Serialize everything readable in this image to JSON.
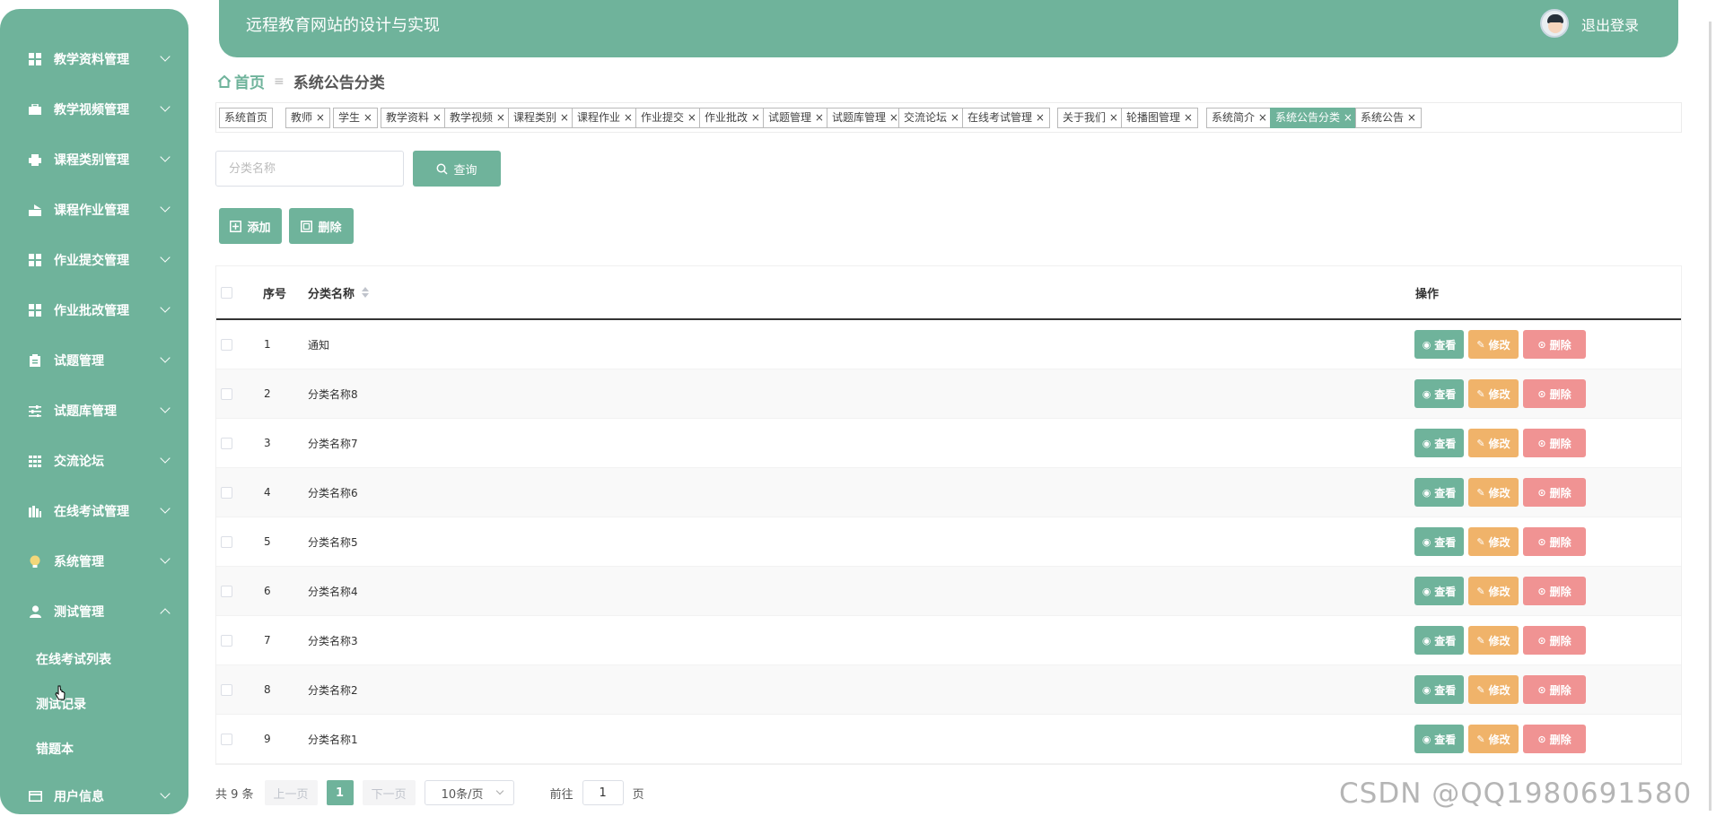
{
  "sidebar": {
    "items": [
      {
        "label": "教学资料管理",
        "icon": "grid-icon"
      },
      {
        "label": "教学视频管理",
        "icon": "briefcase-icon"
      },
      {
        "label": "课程类别管理",
        "icon": "printer-icon"
      },
      {
        "label": "课程作业管理",
        "icon": "chart-icon"
      },
      {
        "label": "作业提交管理",
        "icon": "grid-icon"
      },
      {
        "label": "作业批改管理",
        "icon": "grid-icon"
      },
      {
        "label": "试题管理",
        "icon": "clipboard-icon"
      },
      {
        "label": "试题库管理",
        "icon": "sliders-icon"
      },
      {
        "label": "交流论坛",
        "icon": "table-icon"
      },
      {
        "label": "在线考试管理",
        "icon": "bars-icon"
      },
      {
        "label": "系统管理",
        "icon": "bulb-icon"
      },
      {
        "label": "测试管理",
        "icon": "user-icon"
      }
    ],
    "sub_items": [
      "在线考试列表",
      "测试记录",
      "错题本"
    ],
    "last_item": {
      "label": "用户信息",
      "icon": "card-icon"
    }
  },
  "header": {
    "title": "远程教育网站的设计与实现",
    "logout": "退出登录"
  },
  "breadcrumb": {
    "home": "首页",
    "separator": "≡",
    "current": "系统公告分类"
  },
  "tags": [
    "系统首页",
    "教师",
    "学生",
    "教学资料",
    "教学视频",
    "课程类别",
    "课程作业",
    "作业提交",
    "作业批改",
    "试题管理",
    "试题库管理",
    "交流论坛",
    "在线考试管理",
    "关于我们",
    "轮播图管理",
    "系统简介",
    "系统公告分类",
    "系统公告"
  ],
  "active_tag": "系统公告分类",
  "search": {
    "placeholder": "分类名称",
    "query_label": "查询"
  },
  "toolbar": {
    "add_label": "添加",
    "delete_label": "删除"
  },
  "table": {
    "headers": {
      "index": "序号",
      "name": "分类名称",
      "ops": "操作"
    },
    "rows": [
      {
        "index": "1",
        "name": "通知"
      },
      {
        "index": "2",
        "name": "分类名称8"
      },
      {
        "index": "3",
        "name": "分类名称7"
      },
      {
        "index": "4",
        "name": "分类名称6"
      },
      {
        "index": "5",
        "name": "分类名称5"
      },
      {
        "index": "6",
        "name": "分类名称4"
      },
      {
        "index": "7",
        "name": "分类名称3"
      },
      {
        "index": "8",
        "name": "分类名称2"
      },
      {
        "index": "9",
        "name": "分类名称1"
      }
    ],
    "row_actions": {
      "view": "查看",
      "edit": "修改",
      "remove": "删除"
    }
  },
  "pagination": {
    "total": "共 9 条",
    "prev": "上一页",
    "current": "1",
    "next": "下一页",
    "page_size": "10条/页",
    "goto_prefix": "前往",
    "goto_value": "1",
    "goto_suffix": "页"
  },
  "watermark": "CSDN @QQ1980691580",
  "colors": {
    "primary": "#6fb39b",
    "edit": "#f0b36a",
    "remove": "#f09393"
  }
}
